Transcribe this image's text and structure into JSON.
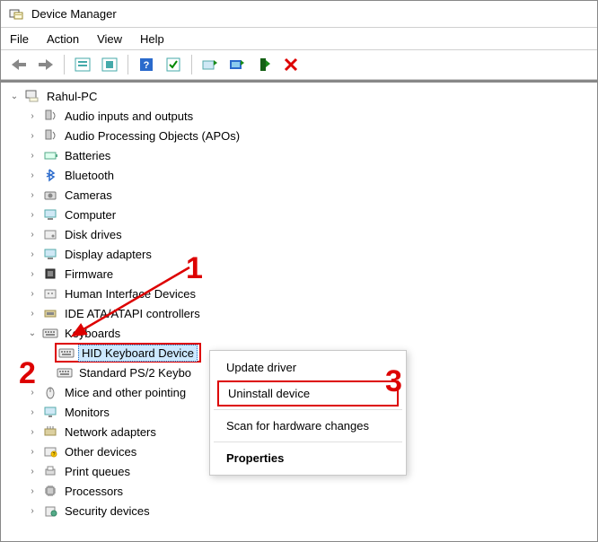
{
  "window": {
    "title": "Device Manager"
  },
  "menu": {
    "file": "File",
    "action": "Action",
    "view": "View",
    "help": "Help"
  },
  "toolbar_icons": {
    "back": "back-arrow-icon",
    "forward": "forward-arrow-icon",
    "show": "show-hidden-icon",
    "help": "help-icon",
    "props": "properties-icon",
    "update": "update-driver-icon",
    "scan": "scan-hardware-icon",
    "add": "add-driver-icon",
    "remove": "remove-icon"
  },
  "tree": {
    "root": "Rahul-PC",
    "items": [
      "Audio inputs and outputs",
      "Audio Processing Objects (APOs)",
      "Batteries",
      "Bluetooth",
      "Cameras",
      "Computer",
      "Disk drives",
      "Display adapters",
      "Firmware",
      "Human Interface Devices",
      "IDE ATA/ATAPI controllers"
    ],
    "keyboards": {
      "label": "Keyboards",
      "children": {
        "hid": "HID Keyboard Device",
        "ps2": "Standard PS/2 Keybo"
      }
    },
    "tail": [
      "Mice and other pointing",
      "Monitors",
      "Network adapters",
      "Other devices",
      "Print queues",
      "Processors",
      "Security devices"
    ]
  },
  "ctx": {
    "update": "Update driver",
    "uninstall": "Uninstall device",
    "scan": "Scan for hardware changes",
    "props": "Properties"
  },
  "anno": {
    "one": "1",
    "two": "2",
    "three": "3"
  }
}
